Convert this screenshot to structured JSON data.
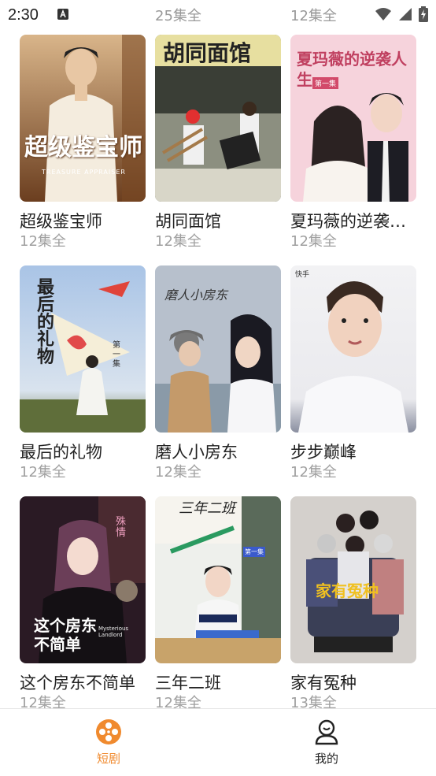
{
  "status": {
    "time": "2:30"
  },
  "top_row_partial": [
    "25集全",
    "12集全"
  ],
  "dramas": [
    {
      "title": "超级鉴宝师",
      "episodes": "12集全",
      "poster_text": "超级鉴宝师",
      "poster_sub": "TREASURE APPRAISER"
    },
    {
      "title": "胡同面馆",
      "episodes": "12集全",
      "poster_text": "胡同面馆"
    },
    {
      "title": "夏玛薇的逆袭…",
      "episodes": "12集全",
      "poster_text": "夏玛薇的逆袭人生",
      "poster_badge": "第一集"
    },
    {
      "title": "最后的礼物",
      "episodes": "12集全",
      "poster_text": "最后的礼物",
      "poster_badge": "第一集"
    },
    {
      "title": "磨人小房东",
      "episodes": "12集全",
      "poster_text": "磨人小房东"
    },
    {
      "title": "步步巅峰",
      "episodes": "12集全",
      "poster_badge": "快手"
    },
    {
      "title": "这个房东不简单",
      "episodes": "12集全",
      "poster_text": "这个房东不简单",
      "poster_sub": "Mysterious Landlord",
      "poster_badge": "殊情"
    },
    {
      "title": "三年二班",
      "episodes": "12集全",
      "poster_text": "三年二班",
      "poster_badge": "第一集"
    },
    {
      "title": "家有冤种",
      "episodes": "13集全",
      "poster_text": "家有冤种"
    }
  ],
  "nav": [
    {
      "label": "短剧",
      "icon": "film-reel-icon",
      "active": true
    },
    {
      "label": "我的",
      "icon": "profile-icon",
      "active": false
    }
  ],
  "colors": {
    "accent": "#f08a2e",
    "text": "#222222",
    "muted": "#a0a0a0"
  }
}
